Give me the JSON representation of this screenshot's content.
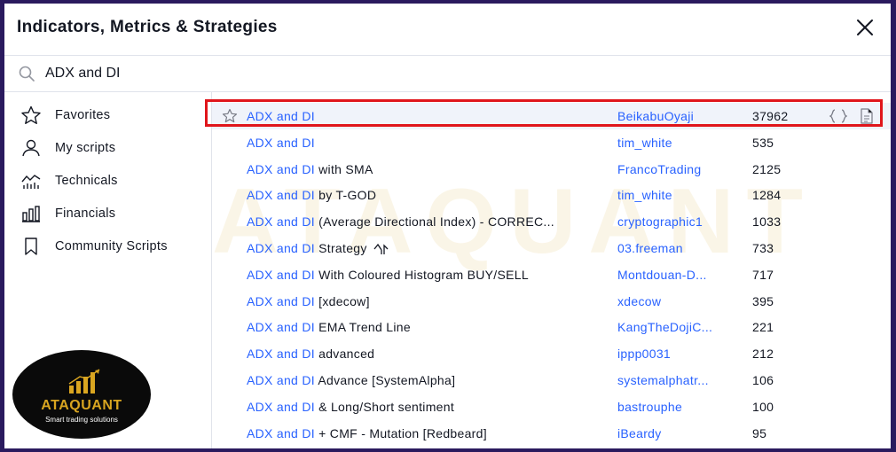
{
  "dialog": {
    "title": "Indicators, Metrics & Strategies"
  },
  "search": {
    "value": "ADX and DI"
  },
  "sidebar": {
    "items": [
      {
        "label": "Favorites",
        "icon": "star-icon"
      },
      {
        "label": "My scripts",
        "icon": "user-icon"
      },
      {
        "label": "Technicals",
        "icon": "technicals-icon"
      },
      {
        "label": "Financials",
        "icon": "financials-icon"
      },
      {
        "label": "Community Scripts",
        "icon": "community-scripts-icon"
      }
    ]
  },
  "watermark": {
    "text": "ATAQUANT"
  },
  "results": [
    {
      "match": "ADX and DI",
      "rest": "",
      "author": "BeikabuOyaji",
      "count": "37962"
    },
    {
      "match": "ADX and DI",
      "rest": "",
      "author": "tim_white",
      "count": "535"
    },
    {
      "match": "ADX and DI",
      "rest": " with SMA",
      "author": "FrancoTrading",
      "count": "2125"
    },
    {
      "match": "ADX and DI",
      "rest": " by T-GOD",
      "author": "tim_white",
      "count": "1284"
    },
    {
      "match": "ADX and DI",
      "rest": " (Average Directional Index) - CORREC...",
      "author": "cryptographic1",
      "count": "1033"
    },
    {
      "match": "ADX and DI",
      "rest": " Strategy",
      "author": "03.freeman",
      "count": "733"
    },
    {
      "match": "ADX and DI",
      "rest": " With Coloured Histogram BUY/SELL",
      "author": "Montdouan-D...",
      "count": "717"
    },
    {
      "match": "ADX and DI",
      "rest": " [xdecow]",
      "author": "xdecow",
      "count": "395"
    },
    {
      "match": "ADX and DI",
      "rest": " EMA Trend Line",
      "author": "KangTheDojiC...",
      "count": "221"
    },
    {
      "match": "ADX and DI",
      "rest": " advanced",
      "author": "ippp0031",
      "count": "212"
    },
    {
      "match": "ADX and DI",
      "rest": " Advance [SystemAlpha]",
      "author": "systemalphatr...",
      "count": "106"
    },
    {
      "match": "ADX and DI",
      "rest": " & Long/Short sentiment",
      "author": "bastrouphe",
      "count": "100"
    },
    {
      "match": "ADX and DI",
      "rest": " + CMF - Mutation [Redbeard]",
      "author": "iBeardy",
      "count": "95"
    }
  ],
  "logo": {
    "brand": "ATAQUANT",
    "tagline": "Smart trading solutions"
  },
  "colors": {
    "accent": "#2962ff",
    "highlight_border": "#e0151b",
    "brand_gold": "#d9a520",
    "frame": "#2a1a5e"
  }
}
